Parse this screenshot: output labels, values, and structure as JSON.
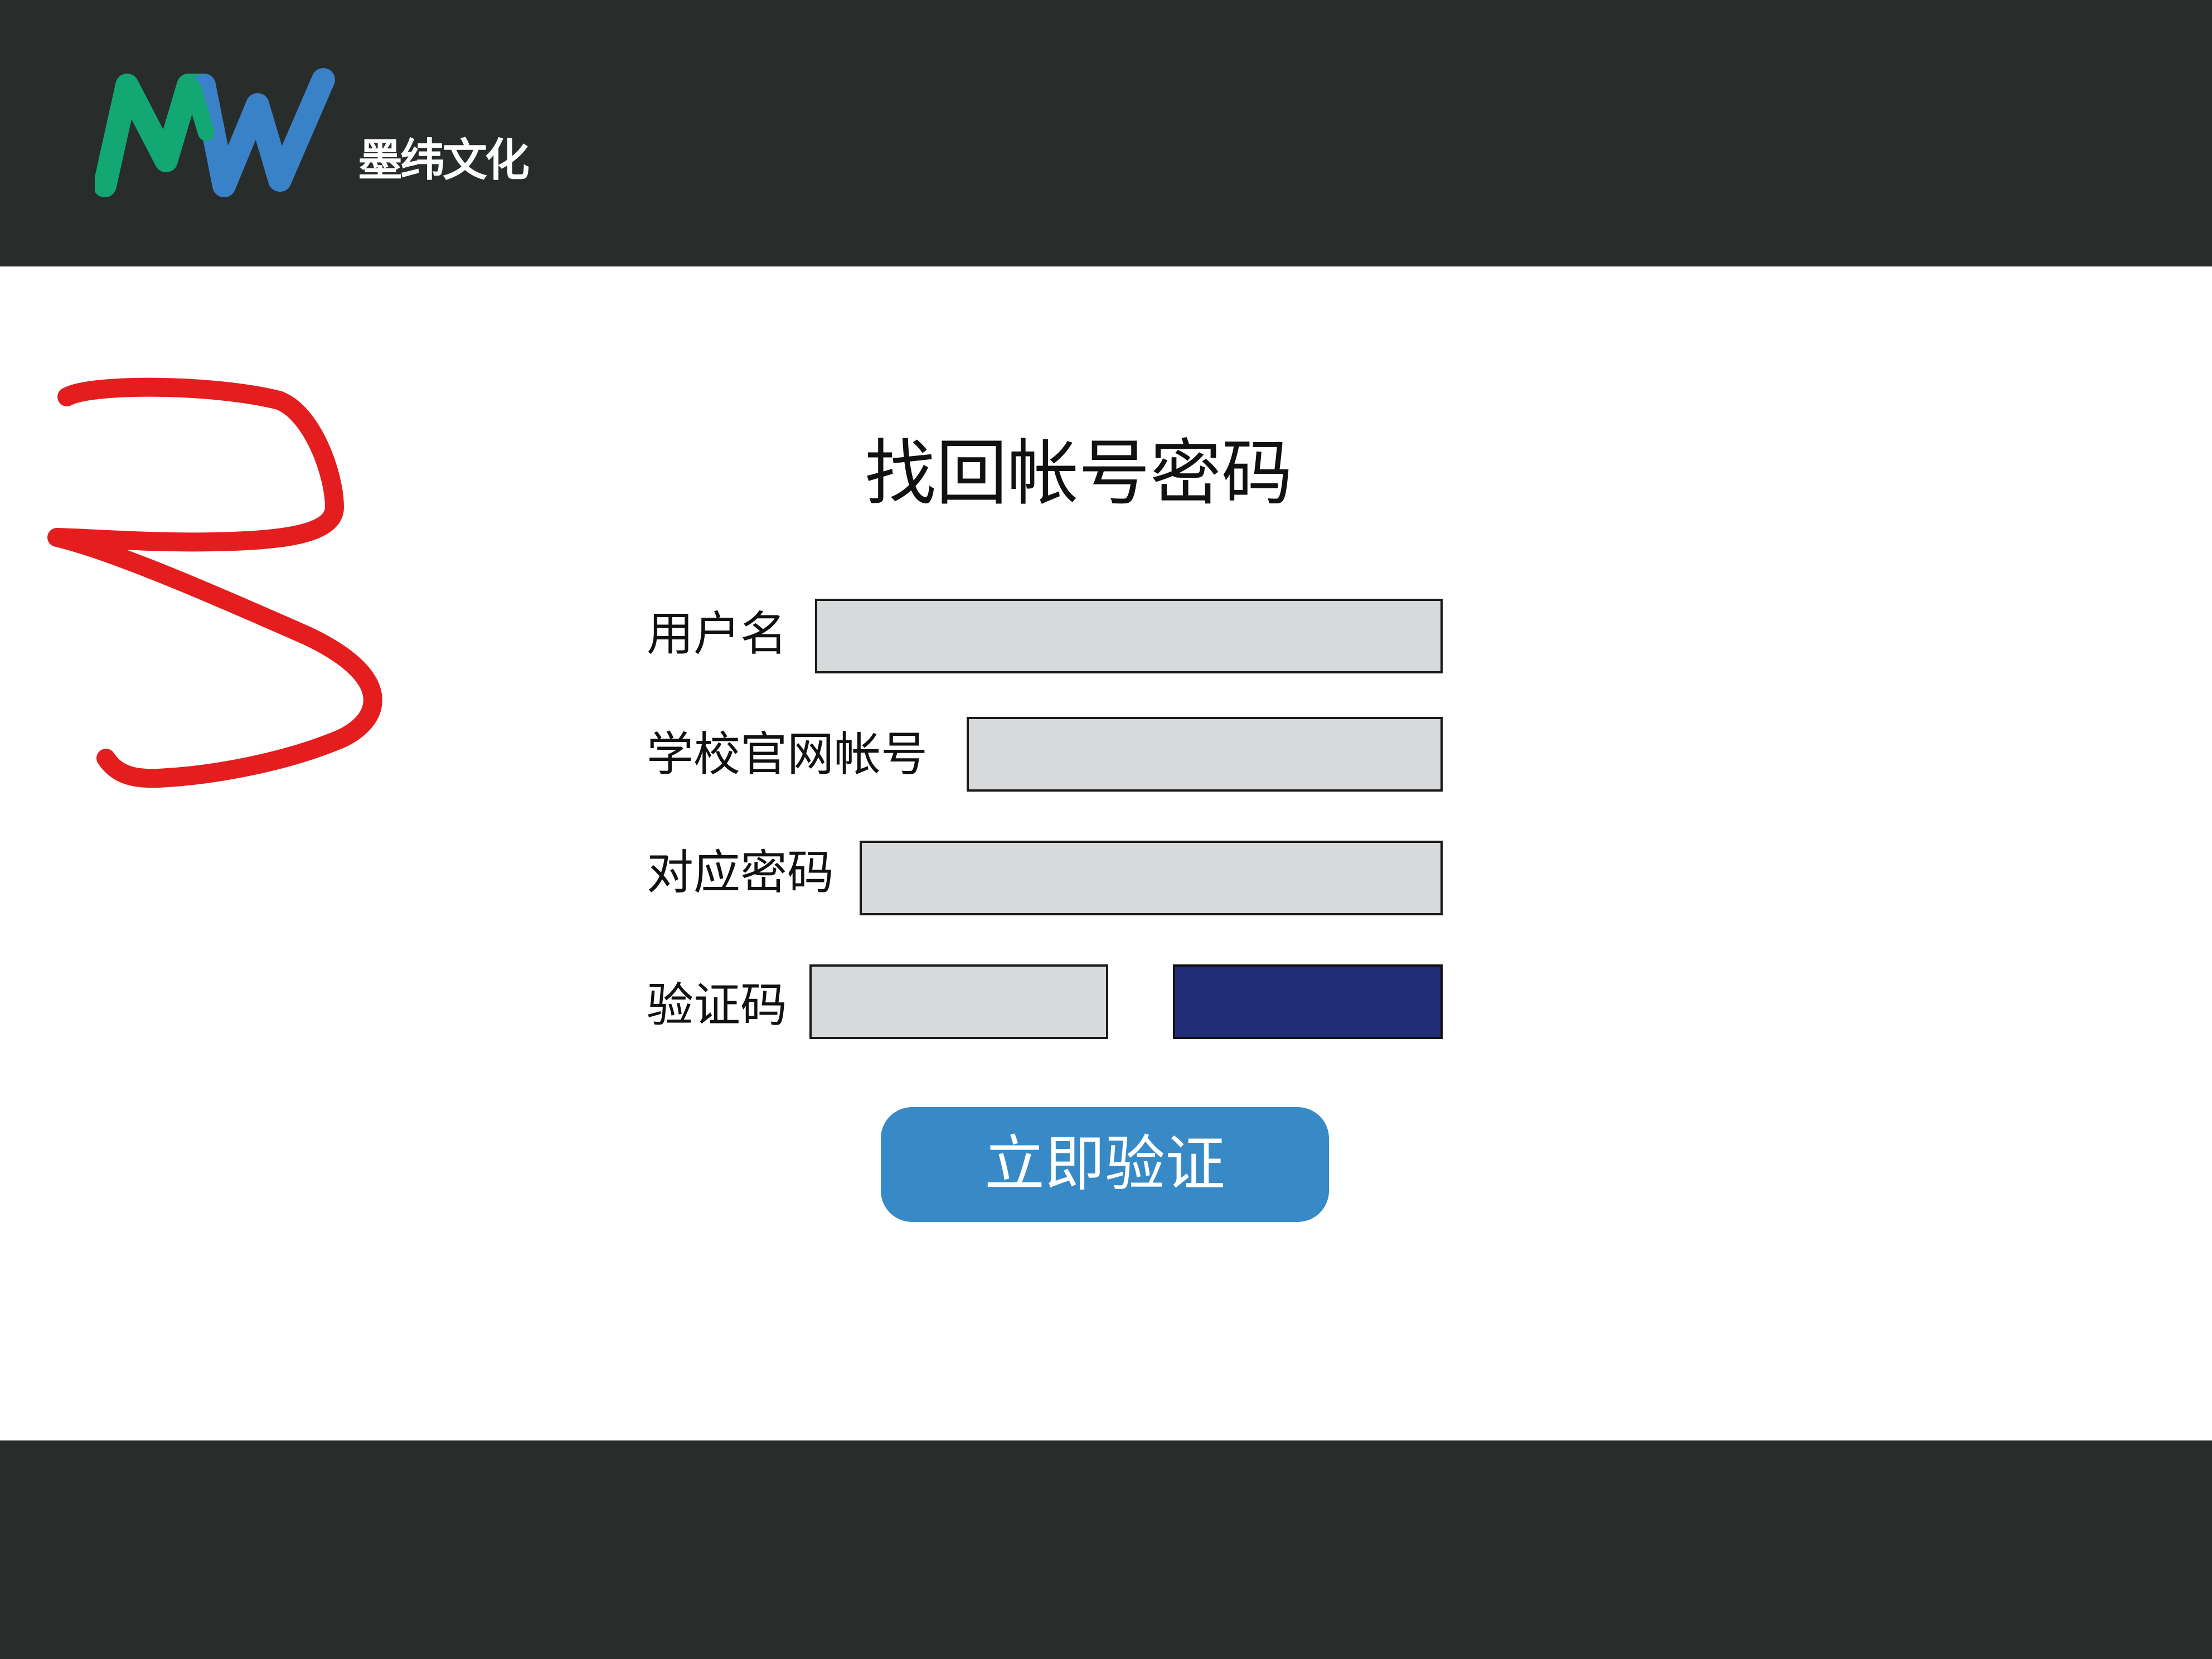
{
  "header": {
    "logo_text": "墨纬文化",
    "logo_colors": {
      "green": "#13a773",
      "blue": "#3a82c8",
      "background": "#282c2b"
    }
  },
  "annotation": {
    "mark": "handwritten-3",
    "color": "#e41e1f"
  },
  "form": {
    "title": "找回帐号密码",
    "fields": [
      {
        "label": "用户名",
        "value": "",
        "placeholder": ""
      },
      {
        "label": "学校官网帐号",
        "value": "",
        "placeholder": ""
      },
      {
        "label": "对应密码",
        "value": "",
        "placeholder": ""
      },
      {
        "label": "验证码",
        "value": "",
        "placeholder": ""
      }
    ],
    "captcha_color": "#212d76",
    "submit_label": "立即验证",
    "submit_color": "#388ac7"
  }
}
